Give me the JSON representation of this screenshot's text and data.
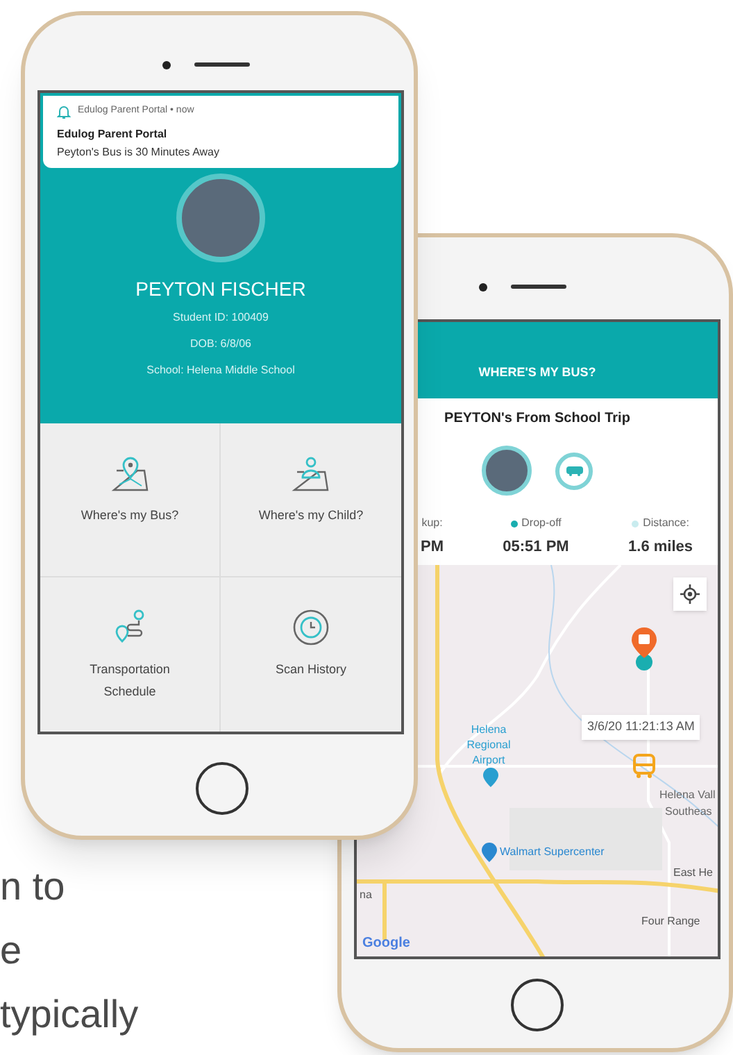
{
  "promo_text": [
    "n to",
    "e",
    "typically"
  ],
  "parent_phone": {
    "notification": {
      "source": "Edulog Parent Portal • now",
      "title": "Edulog Parent Portal",
      "message": "Peyton's Bus is 30 Minutes Away"
    },
    "student": {
      "name": "PEYTON FISCHER",
      "details": [
        "Student ID: 100409",
        "DOB: 6/8/06",
        "School: Helena Middle School"
      ]
    },
    "menu": [
      {
        "label": "Where's my Bus?"
      },
      {
        "label": "Where's my Child?"
      },
      {
        "label": "Transportation Schedule"
      },
      {
        "label": "Scan History"
      }
    ]
  },
  "bus_phone": {
    "header": "WHERE'S MY BUS?",
    "trip_title": "PEYTON's From School Trip",
    "stats": [
      {
        "label": "kup:",
        "value": "PM"
      },
      {
        "label": "Drop-off",
        "value": "05:51 PM",
        "color": "#1aaeb0"
      },
      {
        "label": "Distance:",
        "value": "1.6 miles",
        "color": "#c9ecef"
      }
    ],
    "map": {
      "labels": [
        "Helena Regional Airport",
        "Helena Vall",
        "Southeas",
        "Walmart Supercenter",
        "East He",
        "Four Range",
        "na"
      ],
      "tooltip": "3/6/20 11:21:13 AM",
      "attribution": "Google"
    }
  }
}
